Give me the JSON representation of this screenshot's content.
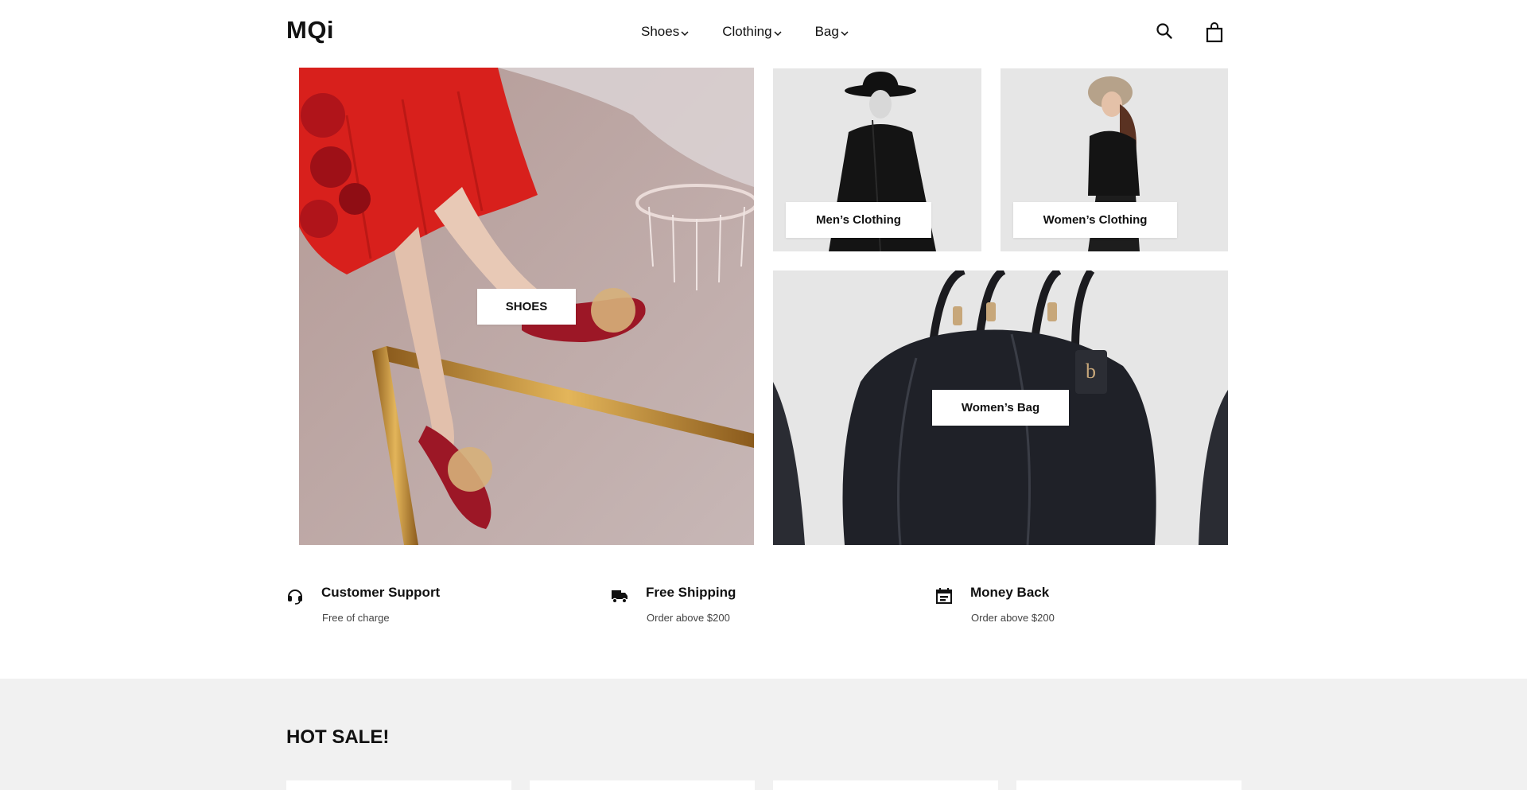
{
  "brand": {
    "logo": "MQi"
  },
  "nav": {
    "items": [
      {
        "label": "Shoes"
      },
      {
        "label": "Clothing"
      },
      {
        "label": "Bag"
      }
    ]
  },
  "header_icons": {
    "search": "search-icon",
    "cart": "shopping-bag-icon"
  },
  "hero": {
    "shoes_label": "SHOES",
    "mens_label": "Men’s Clothing",
    "womens_label": "Women’s Clothing",
    "bag_label": "Women’s Bag"
  },
  "features": [
    {
      "title": "Customer Support",
      "subtitle": "Free of charge",
      "icon": "headset-icon"
    },
    {
      "title": "Free Shipping",
      "subtitle": "Order above $200",
      "icon": "truck-icon"
    },
    {
      "title": "Money Back",
      "subtitle": "Order above $200",
      "icon": "money-calendar-icon"
    }
  ],
  "hot_sale": {
    "title": "HOT SALE!"
  },
  "colors": {
    "text": "#111111",
    "tile_bg": "#e6e6e6",
    "section_bg": "#f1f1f1",
    "shoe_red": "#9c1726",
    "dress_red": "#d8201c"
  }
}
